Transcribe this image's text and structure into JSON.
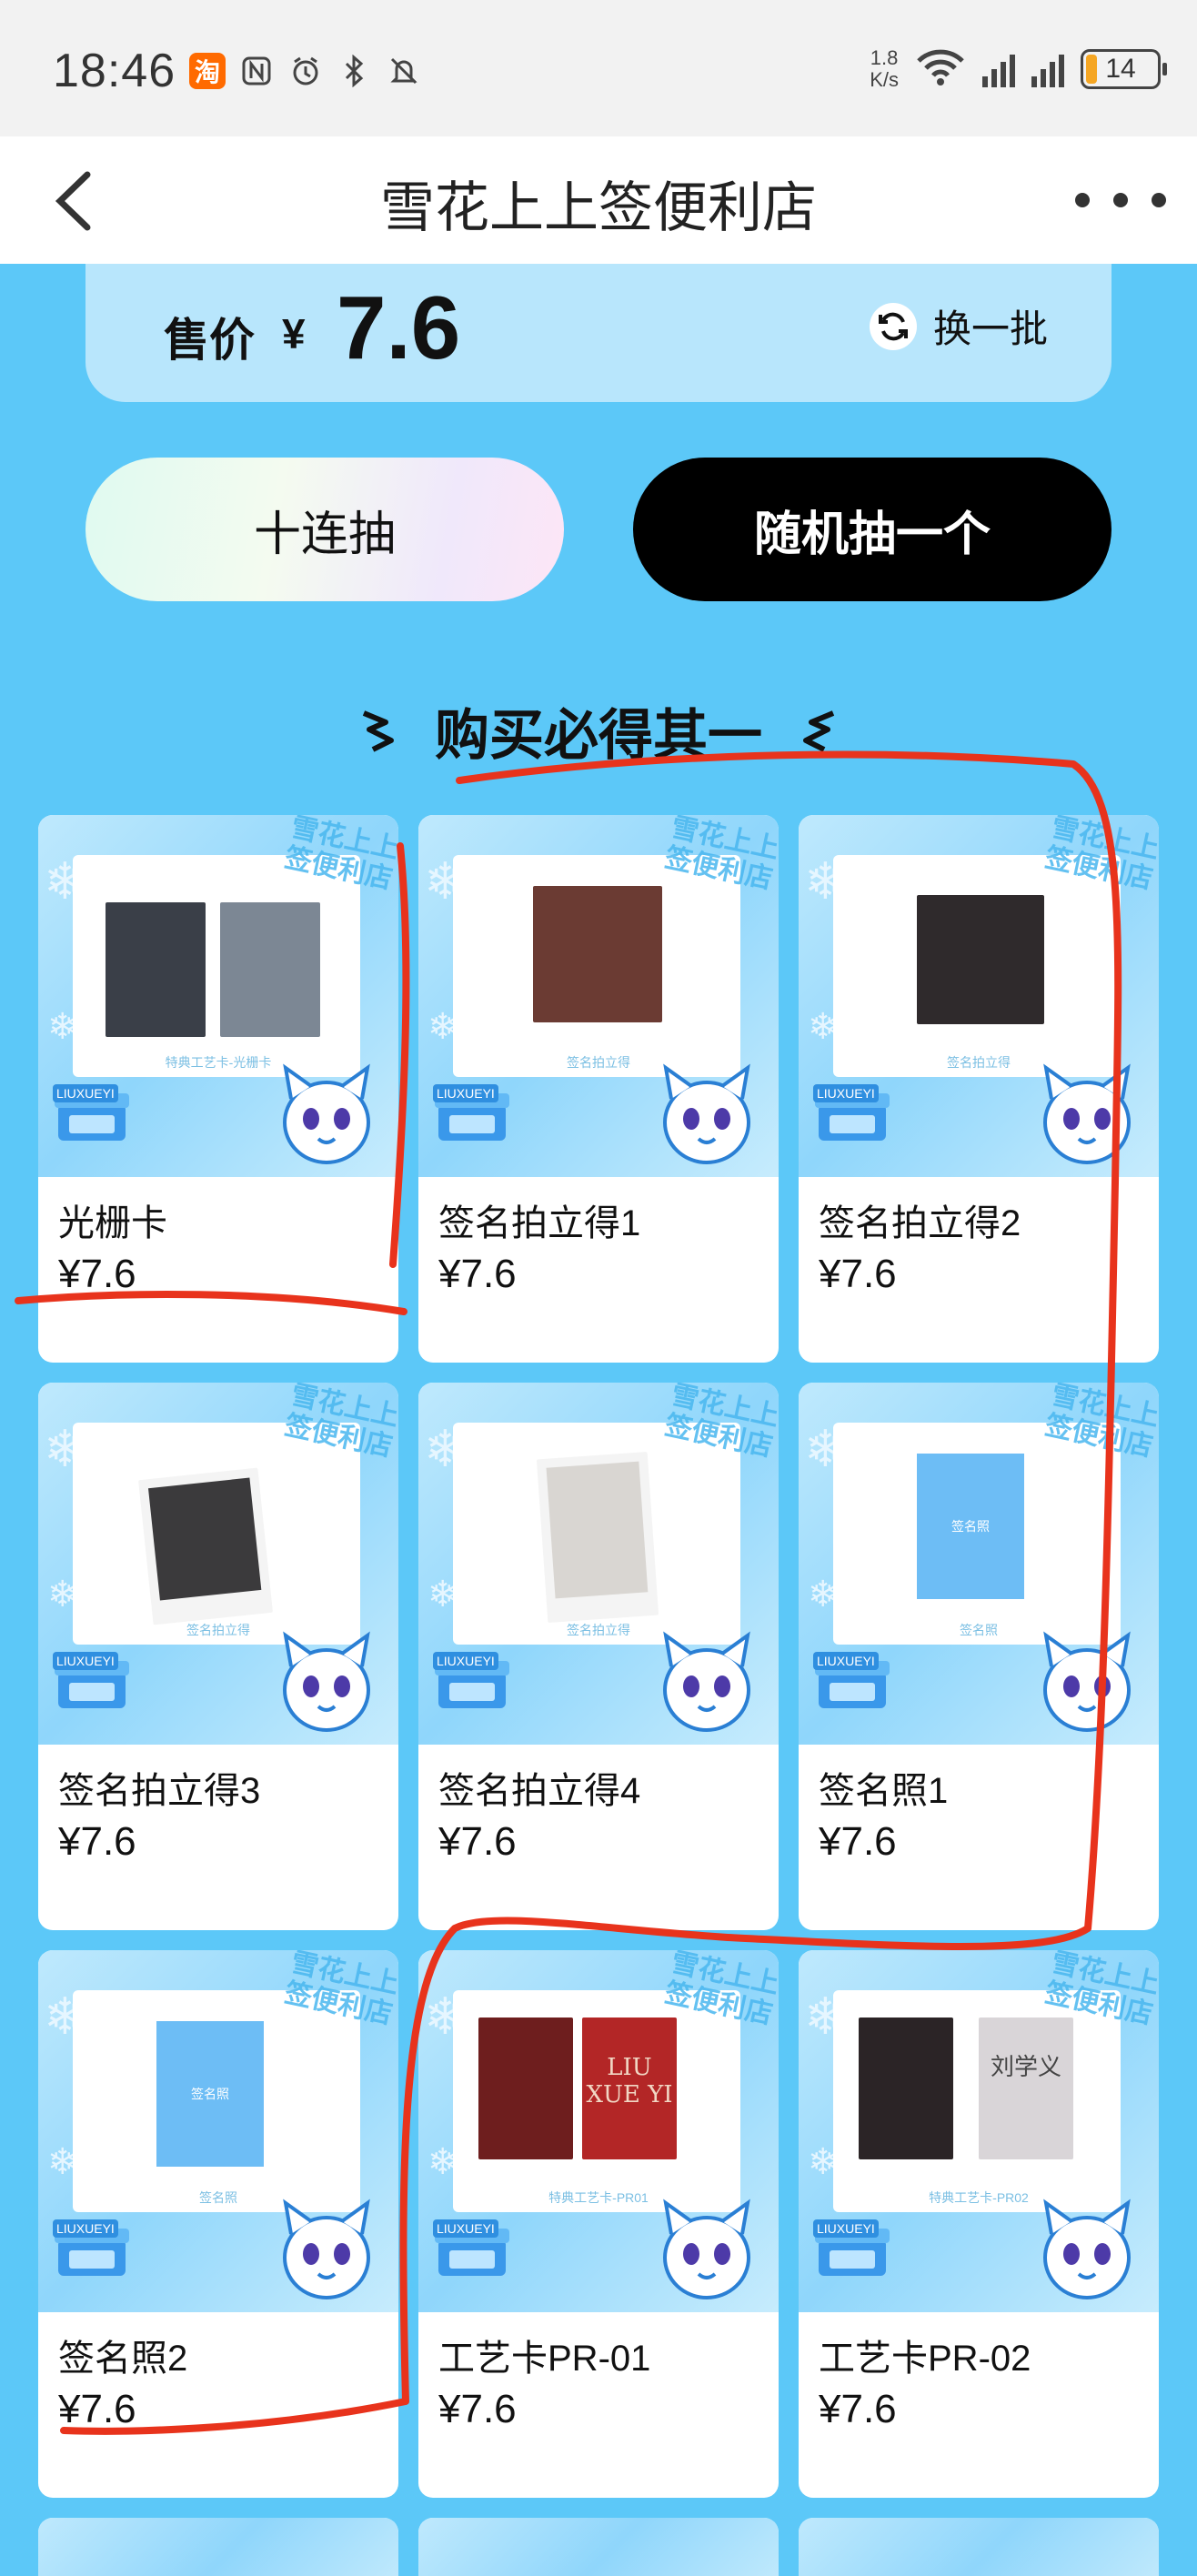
{
  "status_bar": {
    "time": "18:46",
    "left_icons": [
      "taobao-icon",
      "nfc-icon",
      "alarm-icon",
      "bluetooth-icon",
      "mute-icon"
    ],
    "net_speed_value": "1.8",
    "net_speed_unit": "K/s",
    "battery": "14"
  },
  "nav": {
    "title": "雪花上上签便利店"
  },
  "price_panel": {
    "label": "售价",
    "currency": "¥",
    "value": "7.6",
    "refresh_label": "换一批"
  },
  "actions": {
    "ten_draw": "十连抽",
    "random_draw": "随机抽一个"
  },
  "section": {
    "title": "购买必得其一"
  },
  "products": [
    {
      "name": "光栅卡",
      "price": "¥7.6",
      "caption": "特典工艺卡-光栅卡"
    },
    {
      "name": "签名拍立得1",
      "price": "¥7.6",
      "caption": "签名拍立得"
    },
    {
      "name": "签名拍立得2",
      "price": "¥7.6",
      "caption": "签名拍立得"
    },
    {
      "name": "签名拍立得3",
      "price": "¥7.6",
      "caption": "签名拍立得"
    },
    {
      "name": "签名拍立得4",
      "price": "¥7.6",
      "caption": "签名拍立得"
    },
    {
      "name": "签名照1",
      "price": "¥7.6",
      "caption": "签名照",
      "placeholder": "签名照"
    },
    {
      "name": "签名照2",
      "price": "¥7.6",
      "caption": "签名照",
      "placeholder": "签名照"
    },
    {
      "name": "工艺卡PR-01",
      "price": "¥7.6",
      "caption": "特典工艺卡-PR01",
      "card_text": "LIU XUE YI"
    },
    {
      "name": "工艺卡PR-02",
      "price": "¥7.6",
      "caption": "特典工艺卡-PR02",
      "card_text": "刘学义"
    }
  ],
  "card_brand": {
    "watermark": "雪花上上签便利店",
    "store_label": "LIUXUEYI"
  },
  "colors": {
    "background": "#5cc8f8",
    "annotation_red": "#e8331c",
    "random_button": "#000000"
  }
}
